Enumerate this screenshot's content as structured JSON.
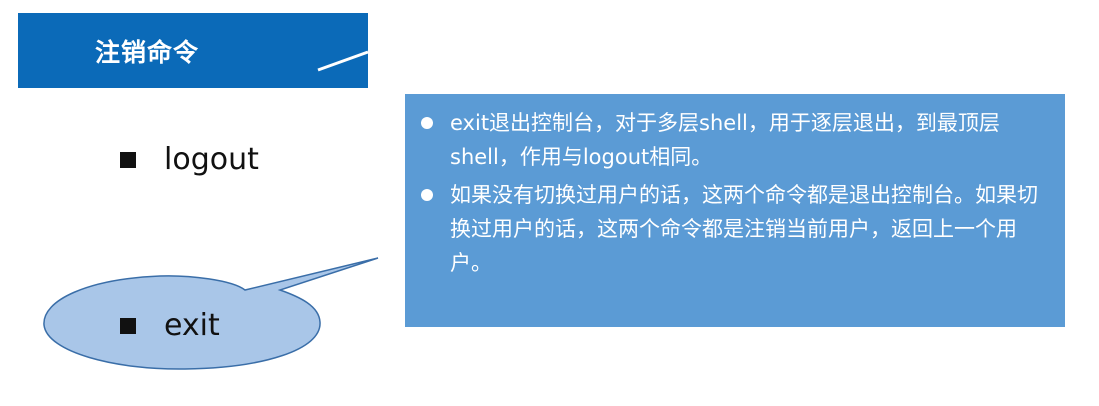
{
  "header": {
    "title": "注销命令"
  },
  "commands": [
    {
      "label": "logout"
    },
    {
      "label": "exit"
    }
  ],
  "info": {
    "bullets": [
      "exit退出控制台，对于多层shell，用于逐层退出，到最顶层shell，作用与logout相同。",
      "如果没有切换过用户的话，这两个命令都是退出控制台。如果切换过用户的话，这两个命令都是注销当前用户，返回上一个用户。"
    ]
  },
  "colors": {
    "title_bar": "#0b6ab8",
    "info_box": "#5b9bd5",
    "callout_fill": "#a9c6e8",
    "callout_stroke": "#3a6ea8"
  }
}
